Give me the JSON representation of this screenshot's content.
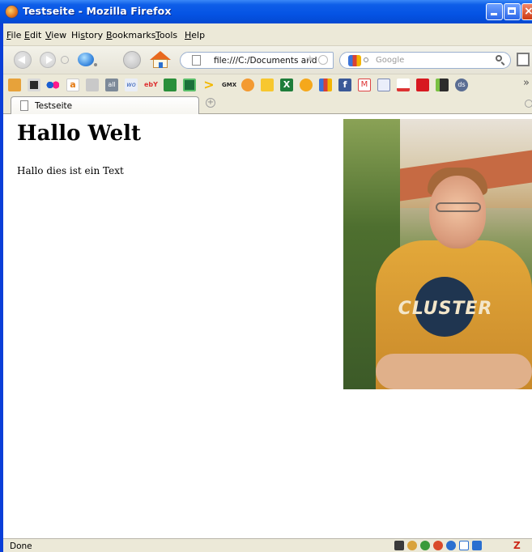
{
  "window": {
    "title": "Testseite - Mozilla Firefox"
  },
  "menu": {
    "items": [
      {
        "key": "F",
        "rest": "ile"
      },
      {
        "key": "E",
        "rest": "dit"
      },
      {
        "key": "V",
        "rest": "iew"
      },
      {
        "key": "H",
        "rest": "istory",
        "pre": "Hi",
        "k2": "s",
        "post": "tory"
      },
      {
        "key": "B",
        "rest": "ookmarks"
      },
      {
        "key": "T",
        "rest": "ools"
      },
      {
        "key": "H",
        "rest": "elp"
      }
    ]
  },
  "navigation": {
    "url": "file:///C:/Documents and",
    "search_placeholder": "Google"
  },
  "bookmarks": {
    "icons": [
      "folder-icon",
      "notebook-icon",
      "flickr-icon",
      "amazon-icon",
      "puzzle-icon",
      "all-icon",
      "wiki-icon",
      "ebay-icon",
      "check-icon",
      "map-icon",
      "arrow-icon",
      "gmx-icon",
      "chart-icon",
      "stack-icon",
      "excel-icon",
      "dict-icon",
      "google-icon",
      "facebook-icon",
      "gmail-icon",
      "calendar-icon",
      "delicious-icon",
      "adobe-icon",
      "bookmark-icon",
      "ds-icon"
    ],
    "more": "»"
  },
  "tab": {
    "label": "Testseite"
  },
  "page": {
    "heading": "Hallo Welt",
    "paragraph": "Hallo dies ist ein Text",
    "photo_shirt_text": "CLUSTER"
  },
  "status": {
    "text": "Done",
    "zotero": "Z"
  },
  "colors": {
    "titlebar": "#0553e4",
    "chrome": "#ece9d8"
  }
}
